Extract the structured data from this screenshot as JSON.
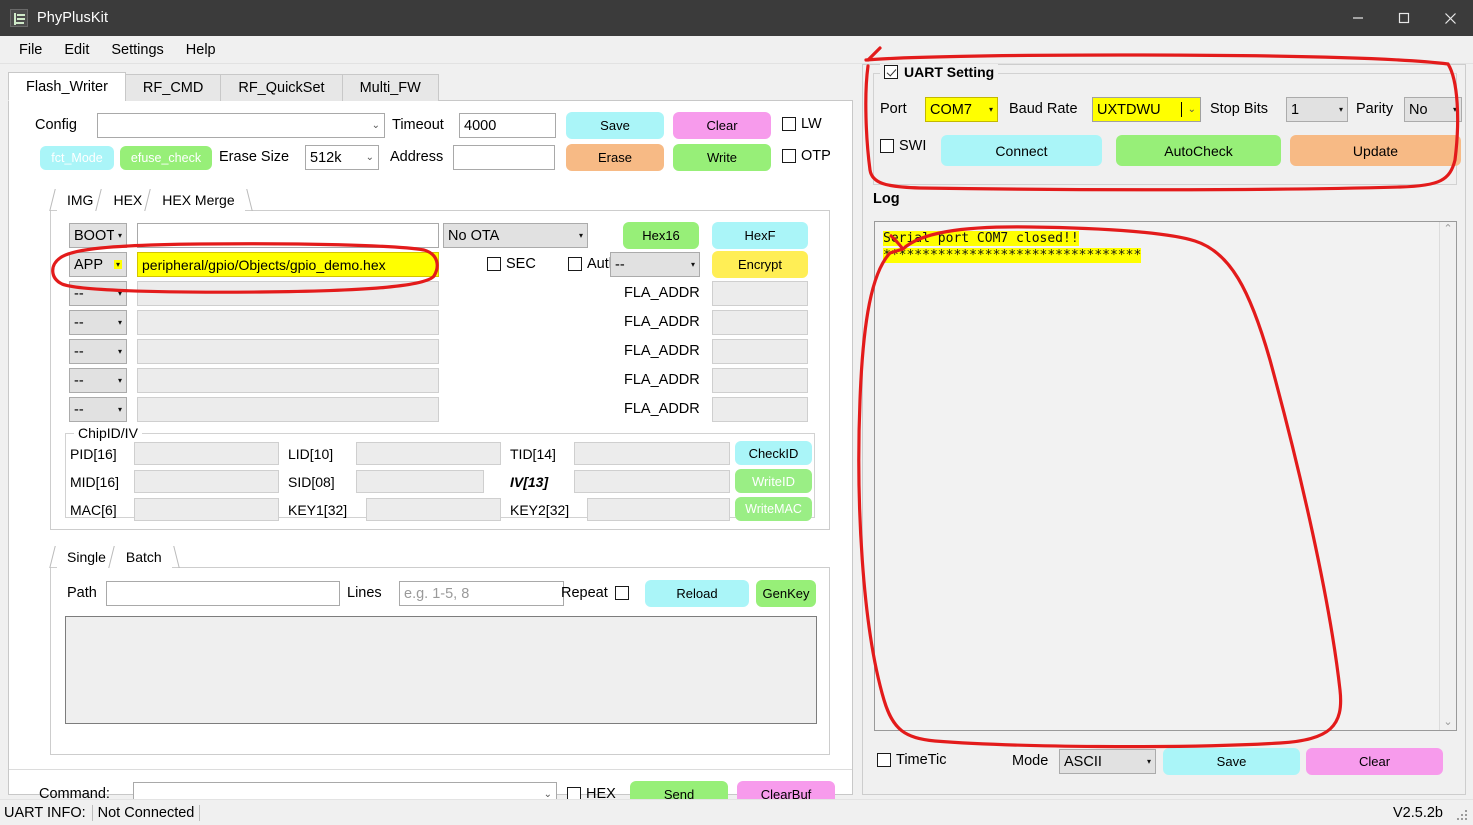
{
  "window": {
    "title": "PhyPlusKit",
    "icon": "app-icon",
    "minimize": "minimize-icon",
    "maximize": "maximize-icon",
    "close": "close-icon"
  },
  "menubar": {
    "items": [
      "File",
      "Edit",
      "Settings",
      "Help"
    ]
  },
  "tabs": {
    "items": [
      "Flash_Writer",
      "RF_CMD",
      "RF_QuickSet",
      "Multi_FW"
    ],
    "active": "Flash_Writer"
  },
  "config": {
    "config_label": "Config",
    "config_value": "",
    "timeout_label": "Timeout",
    "timeout_value": "4000",
    "save_label": "Save",
    "clear_label": "Clear",
    "lw_label": "LW",
    "lw_checked": false,
    "fct_mode_label": "fct_Mode",
    "efuse_check_label": "efuse_check",
    "erase_size_label": "Erase Size",
    "erase_size_value": "512k",
    "address_label": "Address",
    "address_value": "",
    "erase_label": "Erase",
    "write_label": "Write",
    "otp_label": "OTP",
    "otp_checked": false
  },
  "hex_tabs": {
    "items": [
      "IMG",
      "HEX",
      "HEX Merge"
    ],
    "active": "HEX Merge"
  },
  "hex_merge": {
    "row0": {
      "type": "BOOT",
      "path": "",
      "ota_value": "No OTA",
      "hex16_label": "Hex16",
      "hexf_label": "HexF"
    },
    "row1": {
      "type": "APP",
      "path": "peripheral/gpio/Objects/gpio_demo.hex",
      "sec_label": "SEC",
      "sec_checked": false,
      "auth_label": "Auth",
      "auth_checked": false,
      "enc_value": "--",
      "encrypt_label": "Encrypt"
    },
    "extra_rows": [
      {
        "type": "--",
        "path": "",
        "addr_label": "FLA_ADDR",
        "addr_value": ""
      },
      {
        "type": "--",
        "path": "",
        "addr_label": "FLA_ADDR",
        "addr_value": ""
      },
      {
        "type": "--",
        "path": "",
        "addr_label": "FLA_ADDR",
        "addr_value": ""
      },
      {
        "type": "--",
        "path": "",
        "addr_label": "FLA_ADDR",
        "addr_value": ""
      },
      {
        "type": "--",
        "path": "",
        "addr_label": "FLA_ADDR",
        "addr_value": ""
      }
    ]
  },
  "chipid": {
    "title": "ChipID/IV",
    "fields": [
      {
        "label": "PID[16]",
        "value": ""
      },
      {
        "label": "LID[10]",
        "value": ""
      },
      {
        "label": "TID[14]",
        "value": ""
      },
      {
        "label": "MID[16]",
        "value": ""
      },
      {
        "label": "SID[08]",
        "value": ""
      },
      {
        "label": "IV[13]",
        "value": ""
      },
      {
        "label": "MAC[6]",
        "value": ""
      },
      {
        "label": "KEY1[32]",
        "value": ""
      },
      {
        "label": "KEY2[32]",
        "value": ""
      }
    ],
    "checkid_label": "CheckID",
    "writeid_label": "WriteID",
    "writemac_label": "WriteMAC"
  },
  "batch": {
    "tabs": [
      "Single",
      "Batch"
    ],
    "active": "Batch",
    "path_label": "Path",
    "path_value": "",
    "lines_label": "Lines",
    "lines_value": "",
    "lines_placeholder": "e.g. 1-5, 8",
    "repeat_label": "Repeat",
    "repeat_checked": false,
    "reload_label": "Reload",
    "genkey_label": "GenKey",
    "list_content": ""
  },
  "command": {
    "label": "Command:",
    "value": "",
    "hex_label": "HEX",
    "hex_checked": false,
    "send_label": "Send",
    "clearbuf_label": "ClearBuf"
  },
  "uart": {
    "title": "UART Setting",
    "enabled": true,
    "port_label": "Port",
    "port_value": "COM7",
    "baud_label": "Baud Rate",
    "baud_value": "UXTDWU",
    "stop_label": "Stop Bits",
    "stop_value": "1",
    "parity_label": "Parity",
    "parity_value": "No",
    "swd_label": "SWI",
    "swd_checked": false,
    "connect_label": "Connect",
    "autocheck_label": "AutoCheck",
    "update_label": "Update"
  },
  "log": {
    "title": "Log",
    "lines": [
      "Serial port COM7 closed!!",
      "*********************************"
    ],
    "timetic_label": "TimeTic",
    "timetic_checked": false,
    "mode_label": "Mode",
    "mode_value": "ASCII",
    "save_label": "Save",
    "clear_label": "Clear"
  },
  "statusbar": {
    "uart_info_label": "UART INFO:",
    "uart_info_value": "Not Connected",
    "version": "V2.5.2b"
  },
  "colors": {
    "cyan": "#aaf5f8",
    "green": "#97ef78",
    "pink": "#f79bec",
    "orange": "#f7ba85",
    "yellow": "#ffee55",
    "highlight": "#ffff00",
    "annotation": "#e31b1b",
    "titlebar": "#3b3b3b"
  }
}
